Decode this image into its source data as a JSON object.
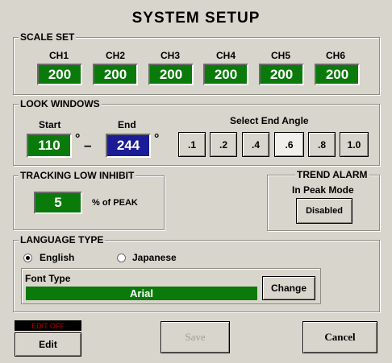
{
  "title": "SYSTEM  SETUP",
  "scale_set": {
    "legend": "SCALE SET",
    "channels": [
      {
        "label": "CH1",
        "value": "200"
      },
      {
        "label": "CH2",
        "value": "200"
      },
      {
        "label": "CH3",
        "value": "200"
      },
      {
        "label": "CH4",
        "value": "200"
      },
      {
        "label": "CH5",
        "value": "200"
      },
      {
        "label": "CH6",
        "value": "200"
      }
    ]
  },
  "look_windows": {
    "legend": "LOOK WINDOWS",
    "start_label": "Start",
    "start_value": "110",
    "degree": "°",
    "dash": "–",
    "end_label": "End",
    "end_value": "244",
    "select_label": "Select End Angle",
    "angles": [
      ".1",
      ".2",
      ".4",
      ".6",
      ".8",
      "1.0"
    ],
    "selected_angle": ".6"
  },
  "tracking": {
    "legend": "TRACKING LOW INHIBIT",
    "value": "5",
    "unit": "% of PEAK"
  },
  "trend_alarm": {
    "legend": "TREND ALARM",
    "mode": "In Peak Mode",
    "button": "Disabled"
  },
  "language": {
    "legend": "LANGUAGE TYPE",
    "options": [
      "English",
      "Japanese"
    ],
    "selected": "English",
    "font_type_label": "Font Type",
    "font_value": "Arial",
    "change_button": "Change"
  },
  "footer": {
    "edit_status": "EDIT OFF",
    "edit_button": "Edit",
    "save_button": "Save",
    "cancel_button": "Cancel"
  },
  "colors": {
    "background": "#d8d5cc",
    "value_green": "#0a7a0a",
    "value_blue": "#1c1c96",
    "edit_status_text": "#b00000"
  }
}
